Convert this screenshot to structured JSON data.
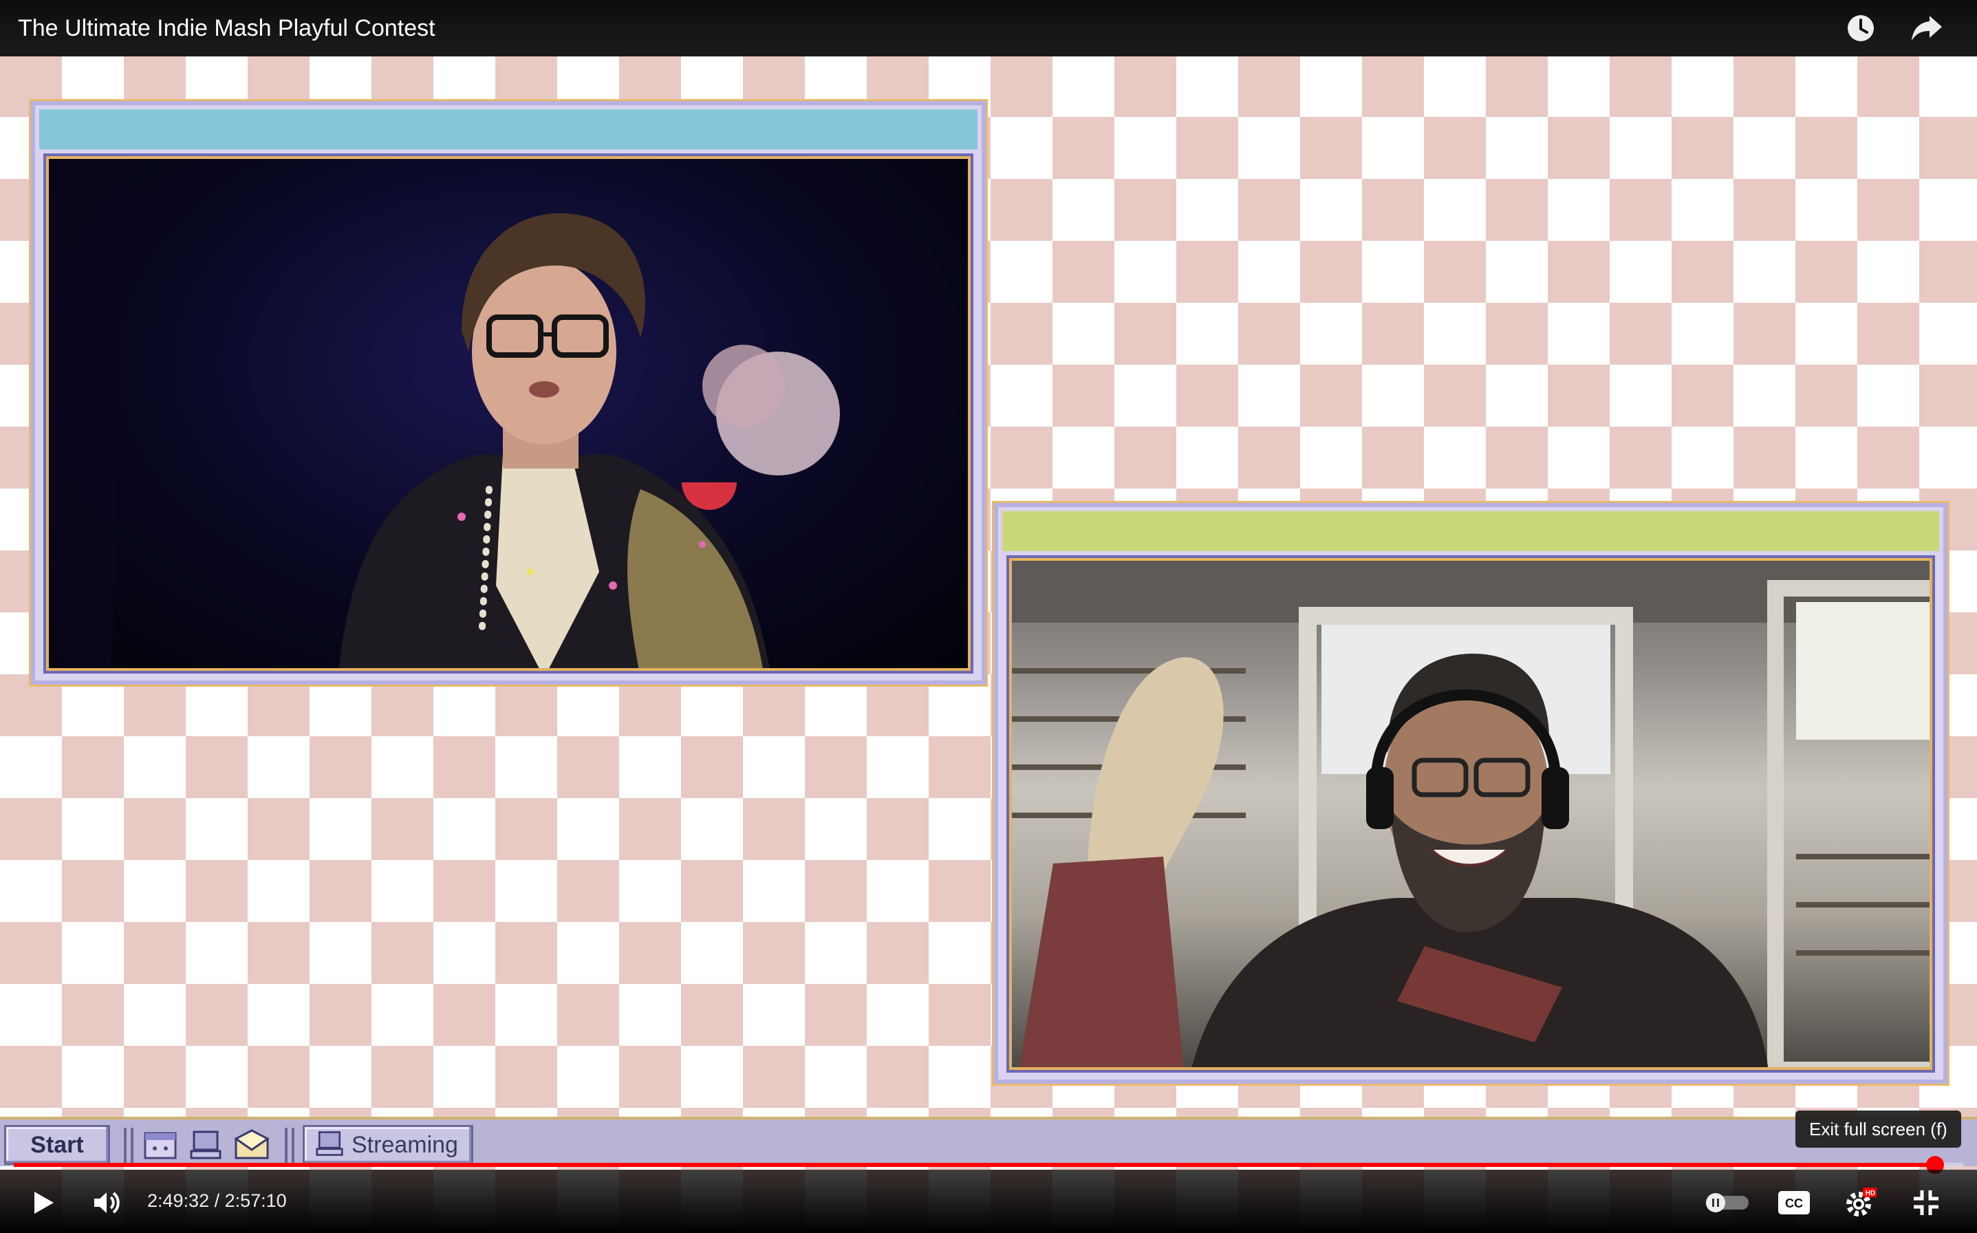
{
  "header": {
    "title": "The Ultimate Indie Mash Playful Contest",
    "icons": [
      "watch-later-icon",
      "share-icon"
    ]
  },
  "windows": [
    {
      "name": "stage-window",
      "titlebar_color": "#86c6d8"
    },
    {
      "name": "webcam-window",
      "titlebar_color": "#c9d97a"
    }
  ],
  "taskbar": {
    "start_label": "Start",
    "quick_launch_icons": [
      "calendar-icon",
      "computer-icon",
      "mail-icon"
    ],
    "task_label": "Streaming"
  },
  "player": {
    "time_display": "2:49:32 / 2:57:10",
    "progress_fraction": 0.9855,
    "tooltip": "Exit full screen (f)",
    "accent_color": "#ff0000",
    "controls": [
      "play-icon",
      "volume-icon",
      "autoplay-toggle",
      "captions-icon",
      "settings-icon",
      "exit-fullscreen-icon"
    ],
    "quality_badge": "HD",
    "captions_label": "CC"
  }
}
